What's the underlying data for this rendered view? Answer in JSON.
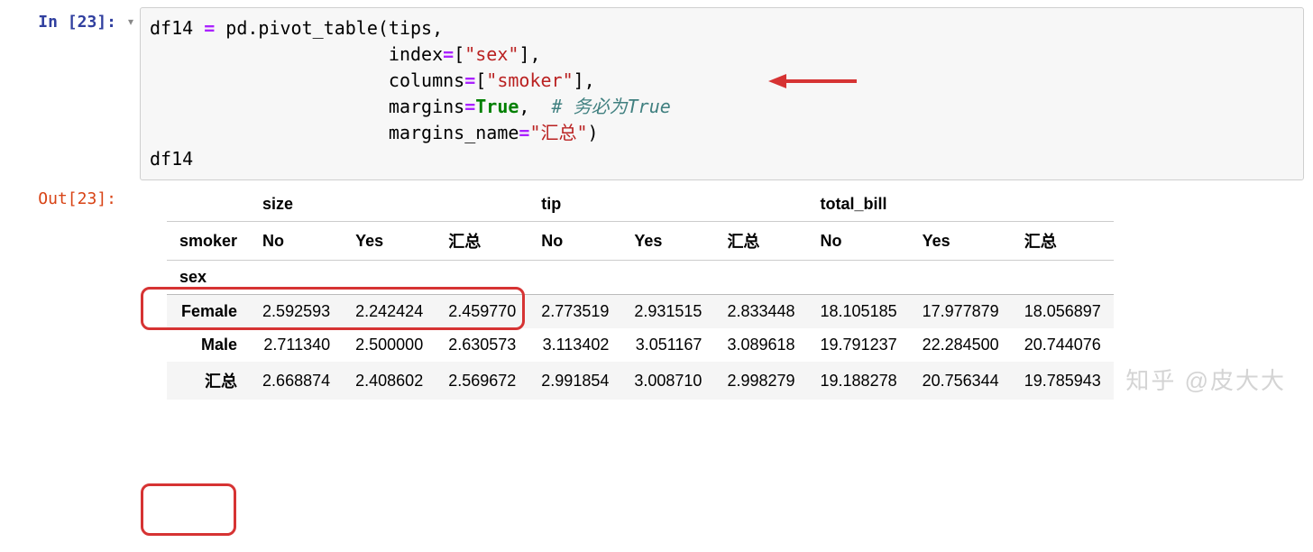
{
  "input_cell": {
    "prompt_label": "In [",
    "prompt_num": "23",
    "prompt_close": "]:",
    "collapser": "▾",
    "code": {
      "line1_var": "df14",
      "line1_eq": " = ",
      "line1_call": "pd.pivot_table(tips,",
      "line2_prefix": "                      ",
      "line2_kw": "index",
      "line2_eq": "=",
      "line2_brkt1": "[",
      "line2_str": "\"sex\"",
      "line2_brkt2": "],",
      "line3_prefix": "                      ",
      "line3_kw": "columns",
      "line3_eq": "=",
      "line3_brkt1": "[",
      "line3_str": "\"smoker\"",
      "line3_brkt2": "],",
      "line4_prefix": "                      ",
      "line4_kw": "margins",
      "line4_eq": "=",
      "line4_val": "True",
      "line4_comma": ",  ",
      "line4_comment": "# 务必为True",
      "line5_prefix": "                      ",
      "line5_kw": "margins_name",
      "line5_eq": "=",
      "line5_str": "\"汇总\"",
      "line5_close": ")",
      "line6": "df14"
    }
  },
  "output_cell": {
    "prompt_label": "Out[",
    "prompt_num": "23",
    "prompt_close": "]:"
  },
  "table": {
    "top_headers": [
      "",
      "size",
      "",
      "",
      "tip",
      "",
      "",
      "total_bill",
      "",
      ""
    ],
    "smoker_label": "smoker",
    "smoker_headers": [
      "No",
      "Yes",
      "汇总",
      "No",
      "Yes",
      "汇总",
      "No",
      "Yes",
      "汇总"
    ],
    "sex_label": "sex",
    "rows": [
      {
        "index": "Female",
        "values": [
          "2.592593",
          "2.242424",
          "2.459770",
          "2.773519",
          "2.931515",
          "2.833448",
          "18.105185",
          "17.977879",
          "18.056897"
        ]
      },
      {
        "index": "Male",
        "values": [
          "2.711340",
          "2.500000",
          "2.630573",
          "3.113402",
          "3.051167",
          "3.089618",
          "19.791237",
          "22.284500",
          "20.744076"
        ]
      },
      {
        "index": "汇总",
        "values": [
          "2.668874",
          "2.408602",
          "2.569672",
          "2.991854",
          "3.008710",
          "2.998279",
          "19.188278",
          "20.756344",
          "19.785943"
        ]
      }
    ]
  },
  "watermark": "知乎 @皮大大"
}
